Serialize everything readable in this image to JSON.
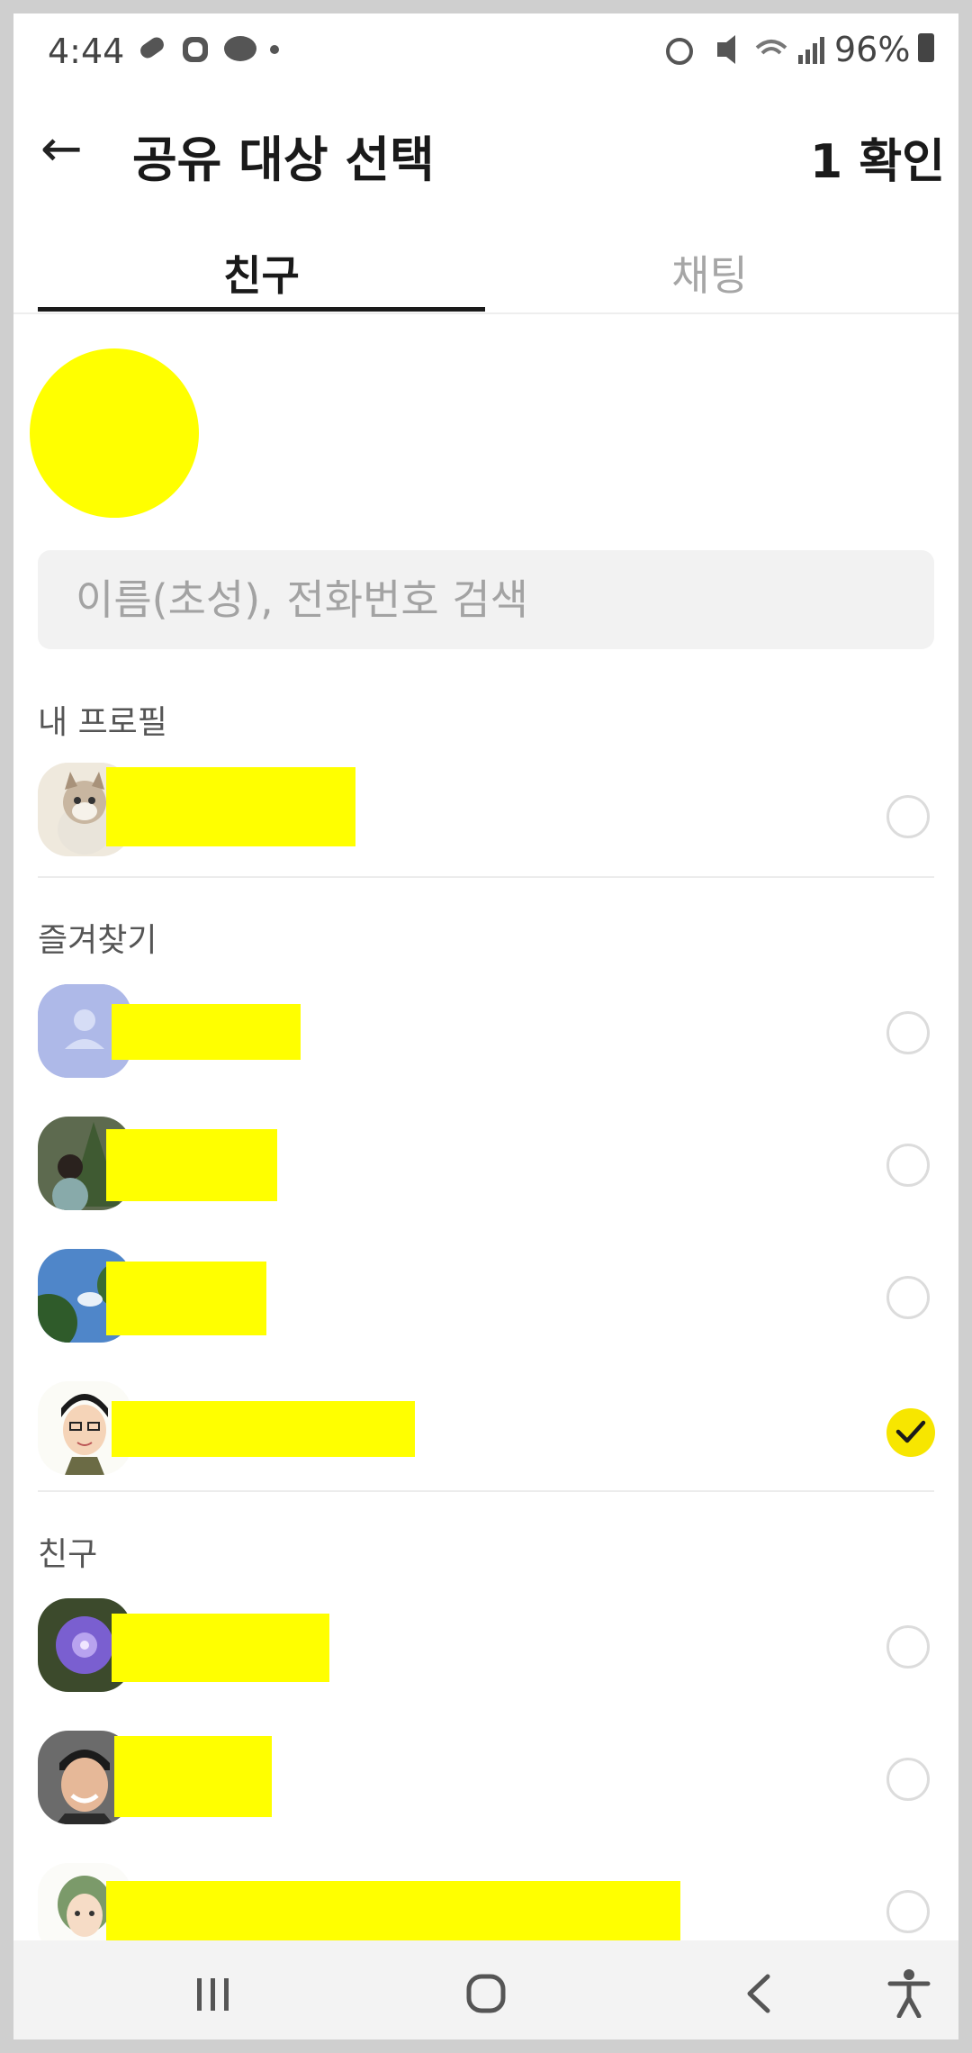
{
  "status_bar": {
    "time": "4:44",
    "icons": "⏰ 🔇 📶 📶",
    "battery": "96%"
  },
  "header": {
    "back_icon": "←",
    "title": "공유 대상 선택",
    "confirm_label": "1 확인"
  },
  "tabs": [
    {
      "label": "친구",
      "active": true
    },
    {
      "label": "채팅",
      "active": false
    }
  ],
  "search": {
    "placeholder": "이름(초성), 전화번호 검색"
  },
  "sections": {
    "my_profile": "내 프로필",
    "favorites": "즐겨찾기",
    "friends": "친구"
  },
  "colors": {
    "accent": "#f7e600",
    "redaction": "#ffff00"
  },
  "navbar": {
    "recents_icon": "|||",
    "home_icon": "▢",
    "back_icon": "‹",
    "accessibility_icon": "♿"
  }
}
